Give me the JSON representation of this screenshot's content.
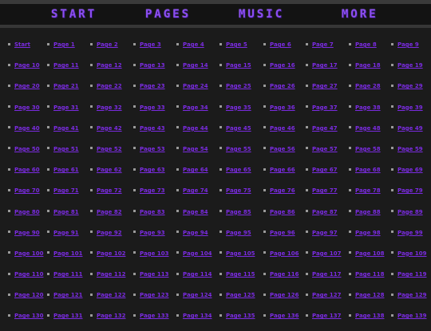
{
  "nav": [
    "START",
    "PAGES",
    "MUSIC",
    "MORE"
  ],
  "links": [
    "Start",
    "Page 1",
    "Page 2",
    "Page 3",
    "Page 4",
    "Page 5",
    "Page 6",
    "Page 7",
    "Page 8",
    "Page 9",
    "Page 10",
    "Page 11",
    "Page 12",
    "Page 13",
    "Page 14",
    "Page 15",
    "Page 16",
    "Page 17",
    "Page 18",
    "Page 19",
    "Page 20",
    "Page 21",
    "Page 22",
    "Page 23",
    "Page 24",
    "Page 25",
    "Page 26",
    "Page 27",
    "Page 28",
    "Page 29",
    "Page 30",
    "Page 31",
    "Page 32",
    "Page 33",
    "Page 34",
    "Page 35",
    "Page 36",
    "Page 37",
    "Page 38",
    "Page 39",
    "Page 40",
    "Page 41",
    "Page 42",
    "Page 43",
    "Page 44",
    "Page 45",
    "Page 46",
    "Page 47",
    "Page 48",
    "Page 49",
    "Page 50",
    "Page 51",
    "Page 52",
    "Page 53",
    "Page 54",
    "Page 55",
    "Page 56",
    "Page 57",
    "Page 58",
    "Page 59",
    "Page 60",
    "Page 61",
    "Page 62",
    "Page 63",
    "Page 64",
    "Page 65",
    "Page 66",
    "Page 67",
    "Page 68",
    "Page 69",
    "Page 70",
    "Page 71",
    "Page 72",
    "Page 73",
    "Page 74",
    "Page 75",
    "Page 76",
    "Page 77",
    "Page 78",
    "Page 79",
    "Page 80",
    "Page 81",
    "Page 82",
    "Page 83",
    "Page 84",
    "Page 85",
    "Page 86",
    "Page 87",
    "Page 88",
    "Page 89",
    "Page 90",
    "Page 91",
    "Page 92",
    "Page 93",
    "Page 94",
    "Page 95",
    "Page 96",
    "Page 97",
    "Page 98",
    "Page 99",
    "Page 100",
    "Page 101",
    "Page 102",
    "Page 103",
    "Page 104",
    "Page 105",
    "Page 106",
    "Page 107",
    "Page 108",
    "Page 109",
    "Page 110",
    "Page 111",
    "Page 112",
    "Page 113",
    "Page 114",
    "Page 115",
    "Page 116",
    "Page 117",
    "Page 118",
    "Page 119",
    "Page 120",
    "Page 121",
    "Page 122",
    "Page 123",
    "Page 124",
    "Page 125",
    "Page 126",
    "Page 127",
    "Page 128",
    "Page 129",
    "Page 130",
    "Page 131",
    "Page 132",
    "Page 133",
    "Page 134",
    "Page 135",
    "Page 136",
    "Page 137",
    "Page 138",
    "Page 139"
  ],
  "colors": {
    "background": "#1b1b1b",
    "nav_bar": "#131313",
    "nav_text": "#8b4df2",
    "link": "#7a2be0",
    "bullet": "#9a9a9a"
  }
}
